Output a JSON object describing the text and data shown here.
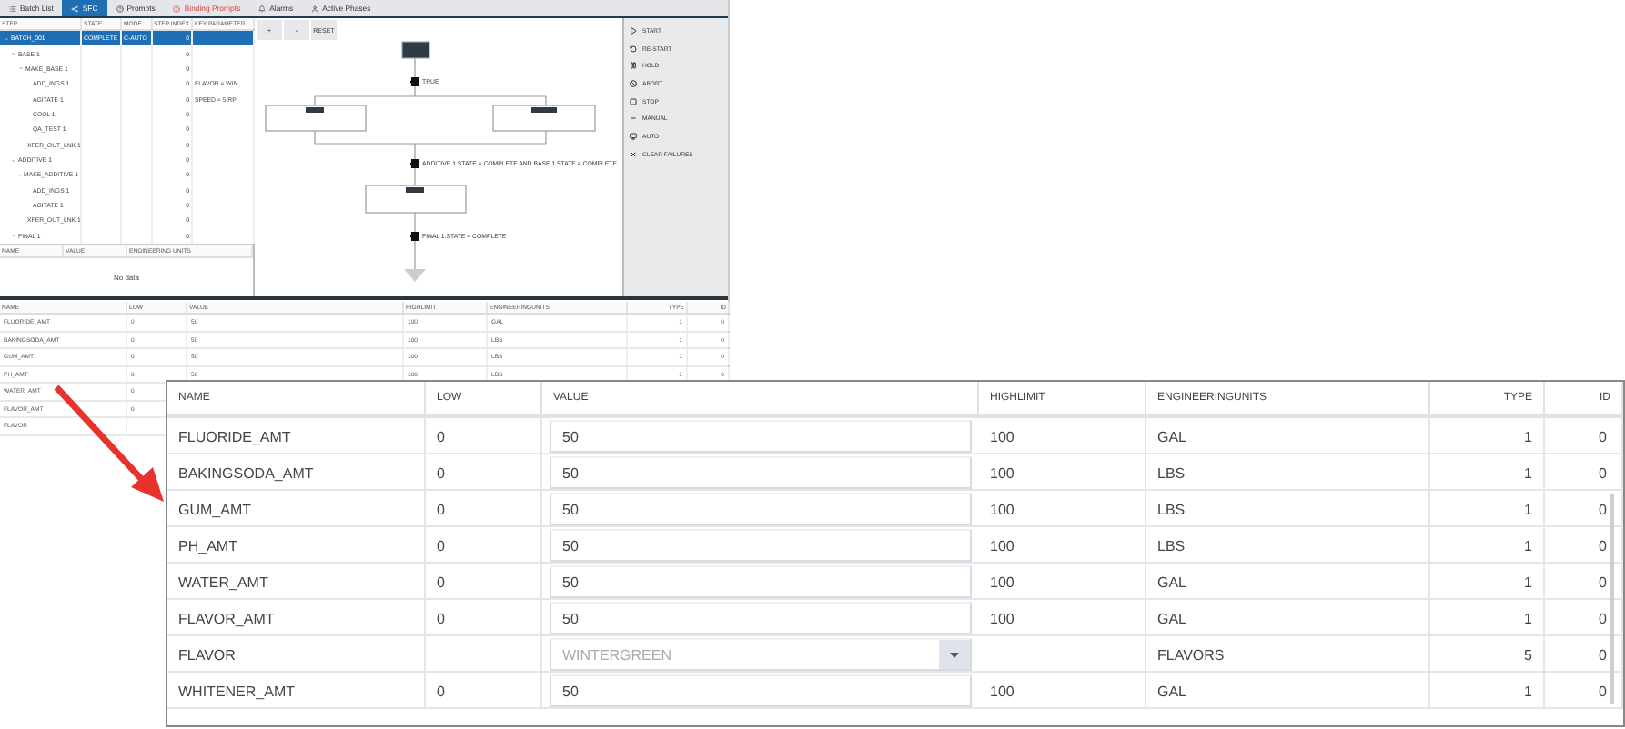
{
  "tabs": [
    {
      "label": "Batch List",
      "selected": false,
      "alert": false
    },
    {
      "label": "SFC",
      "selected": true,
      "alert": false
    },
    {
      "label": "Prompts",
      "selected": false,
      "alert": false
    },
    {
      "label": "Binding Prompts",
      "selected": false,
      "alert": true
    },
    {
      "label": "Alarms",
      "selected": false,
      "alert": false
    },
    {
      "label": "Active Phases",
      "selected": false,
      "alert": false
    }
  ],
  "step_tree": {
    "columns": [
      "STEP",
      "STATE",
      "MODE",
      "STEP INDEX",
      "KEY PARAMETER"
    ],
    "rows": [
      {
        "name": "BATCH_001",
        "state": "COMPLETE",
        "mode": "C-AUTO",
        "step_index": "0",
        "selected": true,
        "expanded": true,
        "children": [
          {
            "name": "BASE 1",
            "step_index": "0",
            "selected": false,
            "expanded": true,
            "children": [
              {
                "name": "MAKE_BASE 1",
                "step_index": "0",
                "selected": false,
                "expanded": true,
                "children": [
                  {
                    "name": "ADD_INGS 1",
                    "step_index": "0",
                    "key_parameter": "FLAVOR = WIN",
                    "selected": false
                  },
                  {
                    "name": "AGITATE 1",
                    "step_index": "0",
                    "key_parameter": "SPEED = 5 RP",
                    "selected": false
                  },
                  {
                    "name": "COOL 1",
                    "step_index": "0",
                    "selected": false
                  },
                  {
                    "name": "QA_TEST 1",
                    "step_index": "0",
                    "selected": false
                  },
                  {
                    "name": "XFER_OUT_LNK 1",
                    "step_index": "0",
                    "selected": false
                  }
                ]
              }
            ]
          },
          {
            "name": "ADDITIVE 1",
            "step_index": "0",
            "selected": false,
            "expanded": true,
            "children": [
              {
                "name": "MAKE_ADDITIVE 1",
                "step_index": "0",
                "selected": false,
                "expanded": true,
                "children": [
                  {
                    "name": "ADD_INGS 1",
                    "step_index": "0",
                    "selected": false
                  },
                  {
                    "name": "AGITATE 1",
                    "step_index": "0",
                    "selected": false
                  },
                  {
                    "name": "XFER_OUT_LNK 1",
                    "step_index": "0",
                    "selected": false
                  }
                ]
              }
            ]
          },
          {
            "name": "FINAL 1",
            "step_index": "0",
            "selected": false,
            "expanded": true
          }
        ]
      }
    ]
  },
  "parameters": {
    "columns": [
      "NAME",
      "VALUE",
      "ENGINEERING UNITS"
    ],
    "empty_text": "No data"
  },
  "diagram": {
    "buttons": [
      "+",
      "-",
      "RESET"
    ],
    "transitions": [
      "TRUE",
      "ADDITIVE 1.STATE = COMPLETE AND BASE 1.STATE = COMPLETE",
      "FINAL 1.STATE = COMPLETE"
    ]
  },
  "commands": [
    {
      "label": "START",
      "kind": "start"
    },
    {
      "label": "RE-START",
      "kind": "restart"
    },
    {
      "label": "HOLD",
      "kind": "hold"
    },
    {
      "label": "ABORT",
      "kind": "abort"
    },
    {
      "label": "STOP",
      "kind": "stop"
    },
    {
      "label": "MANUAL",
      "kind": "manual"
    },
    {
      "label": "AUTO",
      "kind": "auto"
    },
    {
      "label": "CLEAR FAILURES",
      "kind": "clear"
    }
  ],
  "recipe_table": {
    "columns": [
      "NAME",
      "LOW",
      "VALUE",
      "HIGHLIMIT",
      "ENGINEERINGUNITS",
      "TYPE",
      "ID"
    ],
    "rows": [
      [
        "FLUORIDE_AMT",
        "0",
        "50",
        "100",
        "GAL",
        "1",
        "0"
      ],
      [
        "BAKINGSODA_AMT",
        "0",
        "50",
        "100",
        "LBS",
        "1",
        "0"
      ],
      [
        "GUM_AMT",
        "0",
        "50",
        "100",
        "LBS",
        "1",
        "0"
      ],
      [
        "PH_AMT",
        "0",
        "50",
        "100",
        "LBS",
        "1",
        "0"
      ],
      [
        "WATER_AMT",
        "0"
      ],
      [
        "FLAVOR_AMT",
        "0"
      ],
      [
        "FLAVOR"
      ]
    ]
  },
  "zoomed_table": {
    "columns": [
      "NAME",
      "LOW",
      "VALUE",
      "HIGHLIMIT",
      "ENGINEERINGUNITS",
      "TYPE",
      "ID"
    ],
    "rows": [
      {
        "kind": "input",
        "name": "FLUORIDE_AMT",
        "low": "0",
        "value": "50",
        "highlimit": "100",
        "units": "GAL",
        "type": "1",
        "id": "0"
      },
      {
        "kind": "input",
        "name": "BAKINGSODA_AMT",
        "low": "0",
        "value": "50",
        "highlimit": "100",
        "units": "LBS",
        "type": "1",
        "id": "0"
      },
      {
        "kind": "input",
        "name": "GUM_AMT",
        "low": "0",
        "value": "50",
        "highlimit": "100",
        "units": "LBS",
        "type": "1",
        "id": "0"
      },
      {
        "kind": "input",
        "name": "PH_AMT",
        "low": "0",
        "value": "50",
        "highlimit": "100",
        "units": "LBS",
        "type": "1",
        "id": "0"
      },
      {
        "kind": "input",
        "name": "WATER_AMT",
        "low": "0",
        "value": "50",
        "highlimit": "100",
        "units": "GAL",
        "type": "1",
        "id": "0"
      },
      {
        "kind": "input",
        "name": "FLAVOR_AMT",
        "low": "0",
        "value": "50",
        "highlimit": "100",
        "units": "GAL",
        "type": "1",
        "id": "0"
      },
      {
        "kind": "dropdown",
        "name": "FLAVOR",
        "value": "WINTERGREEN",
        "units": "FLAVORS",
        "type": "5",
        "id": "0"
      },
      {
        "kind": "input",
        "name": "WHITENER_AMT",
        "low": "0",
        "value": "50",
        "highlimit": "100",
        "units": "GAL",
        "type": "1",
        "id": "0"
      }
    ]
  }
}
